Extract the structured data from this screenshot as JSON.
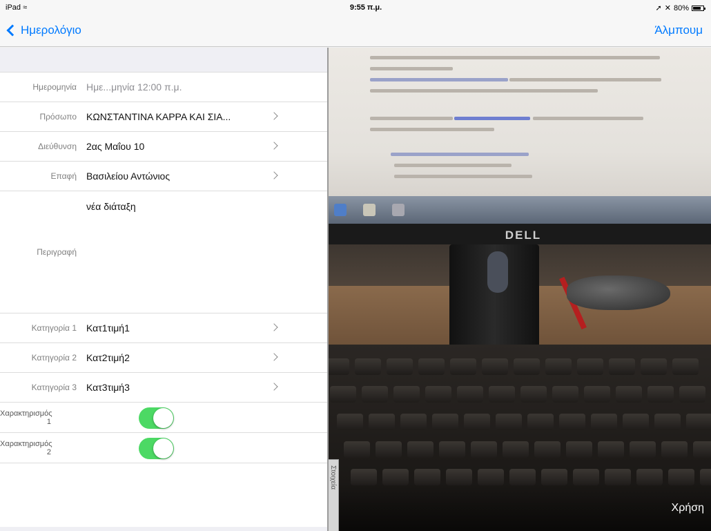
{
  "status": {
    "device": "iPad",
    "time": "9:55 π.μ.",
    "battery": "80%",
    "battery_level": 0.8
  },
  "nav": {
    "back_label": "Ημερολόγιο",
    "save_label": "Άλμπουμ"
  },
  "form": {
    "date": {
      "label": "Ημερομηνία",
      "value": "Ημε...μηνία  12:00 π.μ."
    },
    "person": {
      "label": "Πρόσωπο",
      "value": "ΚΩΝΣΤΑΝΤΙΝΑ ΚΑΡΡΑ ΚΑΙ ΣΙΑ..."
    },
    "address": {
      "label": "Διεύθυνση",
      "value": "2ας Μαΐου 10"
    },
    "contact": {
      "label": "Επαφή",
      "value": "Βασιλείου Αντώνιος"
    },
    "description": {
      "label": "Περιγραφή",
      "value": "νέα διάταξη"
    },
    "category1": {
      "label": "Κατηγορία 1",
      "value": "Κατ1τιμή1"
    },
    "category2": {
      "label": "Κατηγορία 2",
      "value": "Κατ2τιμή2"
    },
    "category3": {
      "label": "Κατηγορία 3",
      "value": "Κατ3τιμή3"
    },
    "trait1": {
      "label": "Χαρακτηρισμός 1",
      "on": true
    },
    "trait2": {
      "label": "Χαρακτηρισμός 2",
      "on": true
    }
  },
  "photo": {
    "side_tab": "Στοιχεία",
    "usage_label": "Χρήση",
    "monitor_brand": "DELL"
  },
  "colors": {
    "accent": "#007aff",
    "switch_on": "#4cd964"
  }
}
